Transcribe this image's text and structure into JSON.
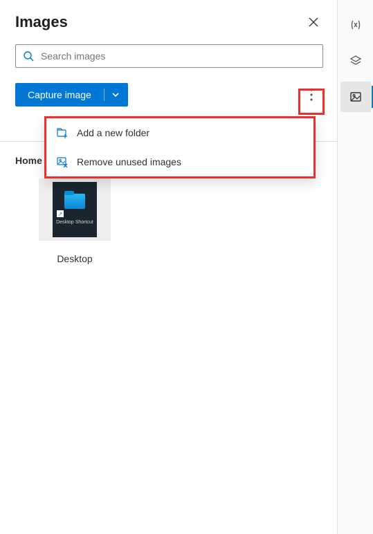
{
  "panel": {
    "title": "Images"
  },
  "search": {
    "placeholder": "Search images"
  },
  "actions": {
    "capture_label": "Capture image"
  },
  "dropdown": {
    "items": [
      {
        "label": "Add a new folder"
      },
      {
        "label": "Remove unused images"
      }
    ]
  },
  "breadcrumb": {
    "root": "Home"
  },
  "items": [
    {
      "label": "Desktop",
      "thumbnail_text": "Desktop Shortcut"
    }
  ],
  "rail": {
    "variables_tooltip": "Variables",
    "layers_tooltip": "UI elements",
    "images_tooltip": "Images"
  },
  "colors": {
    "primary": "#0078d4",
    "highlight": "#ef2e2e"
  }
}
